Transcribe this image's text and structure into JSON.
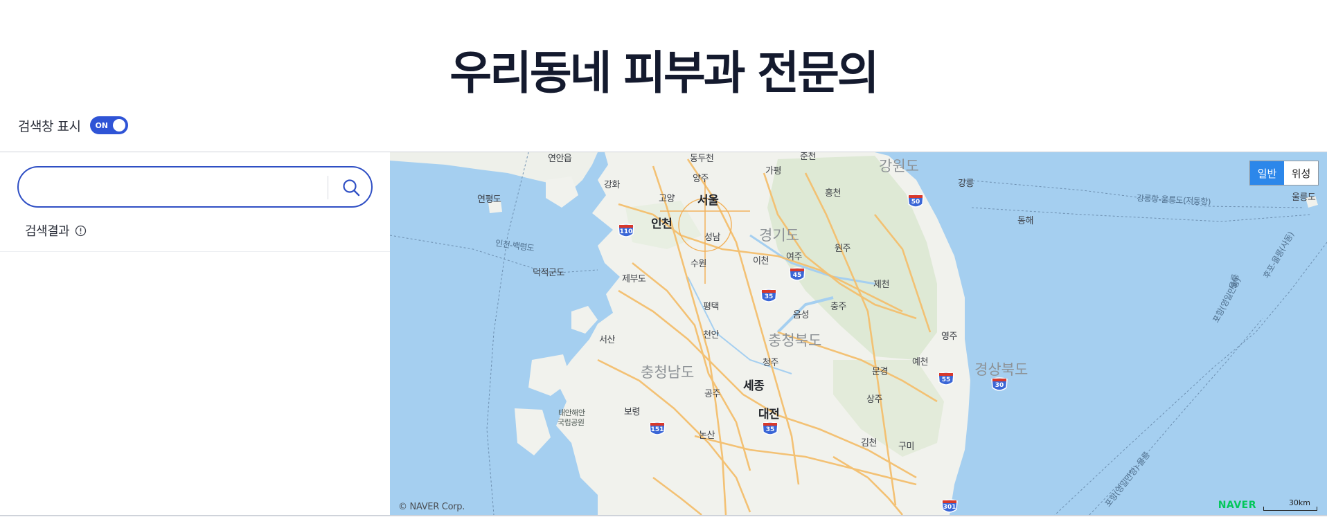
{
  "page": {
    "title": "우리동네 피부과 전문의"
  },
  "toggle": {
    "label": "검색창 표시",
    "state_text": "ON"
  },
  "search": {
    "value": "",
    "placeholder": ""
  },
  "results": {
    "label": "검색결과"
  },
  "map": {
    "map_types": [
      "일반",
      "위성"
    ],
    "active_map_type": "일반",
    "copyright": "© NAVER Corp.",
    "logo": "NAVER",
    "scale": "30km",
    "provinces": [
      "강원도",
      "경기도",
      "충청북도",
      "충청남도",
      "경상북도"
    ],
    "cities": [
      "서울",
      "인천",
      "세종",
      "대전"
    ],
    "places": [
      "연안읍",
      "동두천",
      "춘천",
      "가평",
      "강화",
      "양주",
      "고양",
      "홍천",
      "강릉",
      "연평도",
      "성남",
      "동해",
      "원주",
      "여주",
      "이천",
      "수원",
      "제부도",
      "덕적군도",
      "제천",
      "평택",
      "충주",
      "음성",
      "천안",
      "영주",
      "서산",
      "청주",
      "예천",
      "문경",
      "공주",
      "상주",
      "보령",
      "논산",
      "김천",
      "구미",
      "울릉도"
    ],
    "sea_routes": [
      "인천-백령도",
      "강릉항-울릉도(저동항)",
      "후포-울릉(사동)",
      "포항(영일만항)",
      "울릉",
      "포항(영일만항)-울릉"
    ],
    "park": [
      "태안해안",
      "국립공원"
    ],
    "highways": [
      "110",
      "50",
      "45",
      "35",
      "55",
      "30",
      "151",
      "35",
      "301"
    ]
  },
  "colors": {
    "accent": "#2f54d6",
    "search_border": "#2f4fc4",
    "sea": "#a5cff0",
    "land": "#f1f2ed",
    "road": "#f4bf6e",
    "active_maptype": "#2c87ea",
    "naver_green": "#03c75a"
  }
}
